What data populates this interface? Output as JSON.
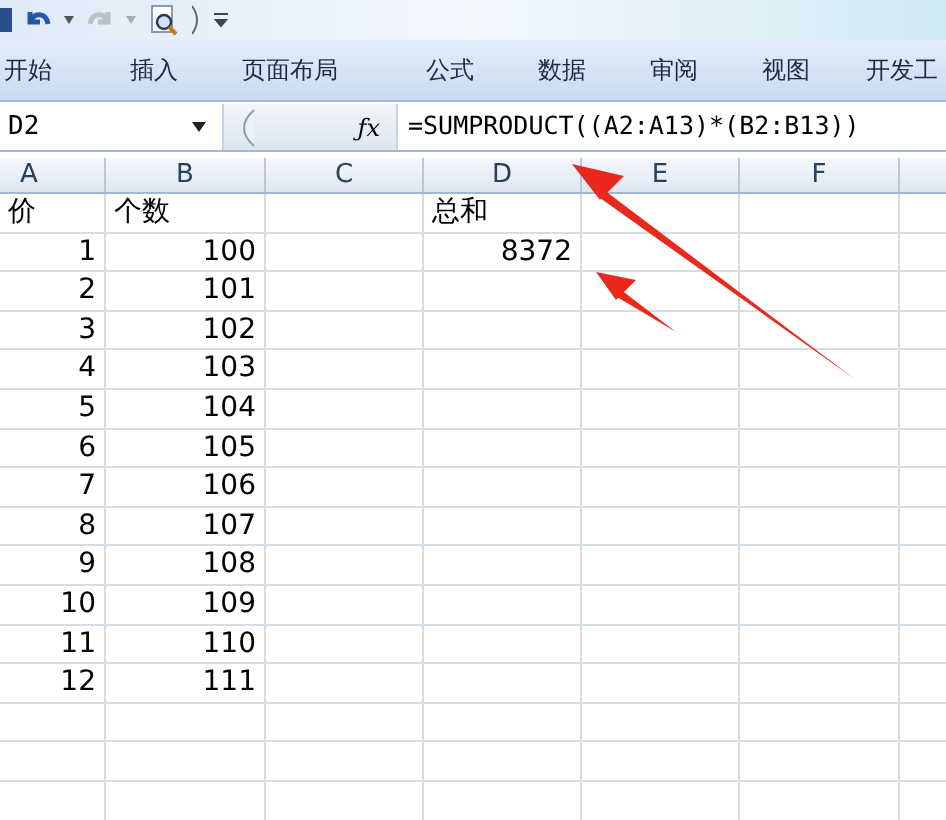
{
  "ribbon_tabs": [
    "开始",
    "插入",
    "页面布局",
    "公式",
    "数据",
    "审阅",
    "视图",
    "开发工"
  ],
  "formula_bar": {
    "name_box": "D2",
    "function_button": "ƒx",
    "formula": "=SUMPRODUCT((A2:A13)*(B2:B13))"
  },
  "columns": [
    "A",
    "B",
    "C",
    "D",
    "E",
    "F"
  ],
  "rows": [
    {
      "kind": "text",
      "cells": [
        "价",
        "个数",
        null,
        "总和"
      ]
    },
    {
      "kind": "number",
      "cells": [
        "1",
        "100",
        null,
        "8372"
      ]
    },
    {
      "kind": "number",
      "cells": [
        "2",
        "101"
      ]
    },
    {
      "kind": "number",
      "cells": [
        "3",
        "102"
      ]
    },
    {
      "kind": "number",
      "cells": [
        "4",
        "103"
      ]
    },
    {
      "kind": "number",
      "cells": [
        "5",
        "104"
      ]
    },
    {
      "kind": "number",
      "cells": [
        "6",
        "105"
      ]
    },
    {
      "kind": "number",
      "cells": [
        "7",
        "106"
      ]
    },
    {
      "kind": "number",
      "cells": [
        "8",
        "107"
      ]
    },
    {
      "kind": "number",
      "cells": [
        "9",
        "108"
      ]
    },
    {
      "kind": "number",
      "cells": [
        "10",
        "109"
      ]
    },
    {
      "kind": "number",
      "cells": [
        "11",
        "110"
      ]
    },
    {
      "kind": "number",
      "cells": [
        "12",
        "111"
      ]
    }
  ]
}
